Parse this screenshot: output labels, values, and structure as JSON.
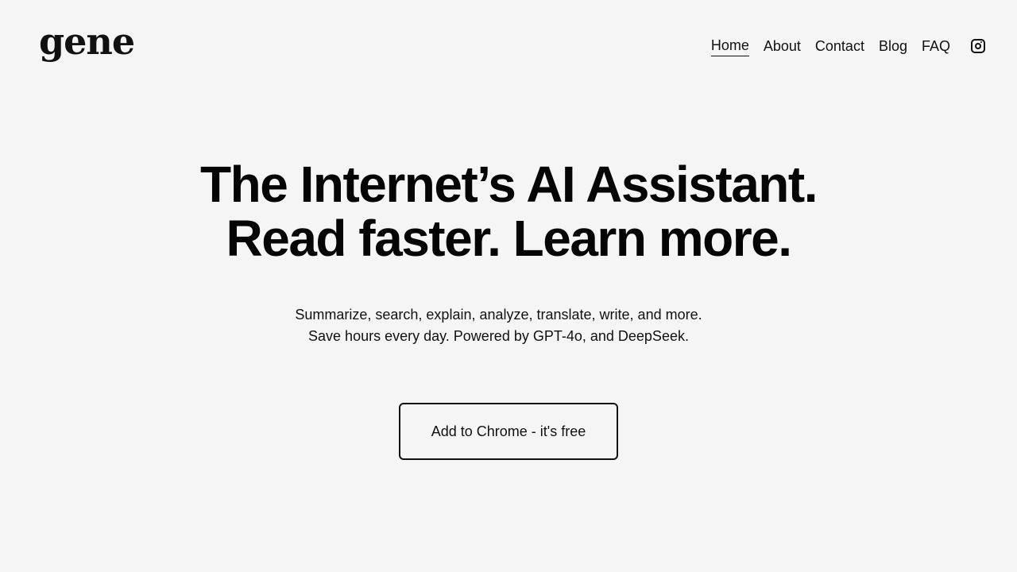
{
  "header": {
    "logo": "gene",
    "nav": [
      {
        "label": "Home",
        "active": true
      },
      {
        "label": "About"
      },
      {
        "label": "Contact"
      },
      {
        "label": "Blog"
      },
      {
        "label": "FAQ"
      }
    ],
    "social_icon": "instagram-icon"
  },
  "hero": {
    "headline_line1": "The Internet’s AI Assistant.",
    "headline_line2": "Read faster. Learn more.",
    "subtext_line1": "Summarize, search, explain, analyze, translate, write, and more.",
    "subtext_line2": "Save hours every day. Powered by GPT-4o, and DeepSeek.",
    "cta_label": "Add to Chrome - it's free"
  },
  "colors": {
    "background": "#f5f5f5",
    "text": "#111111"
  }
}
